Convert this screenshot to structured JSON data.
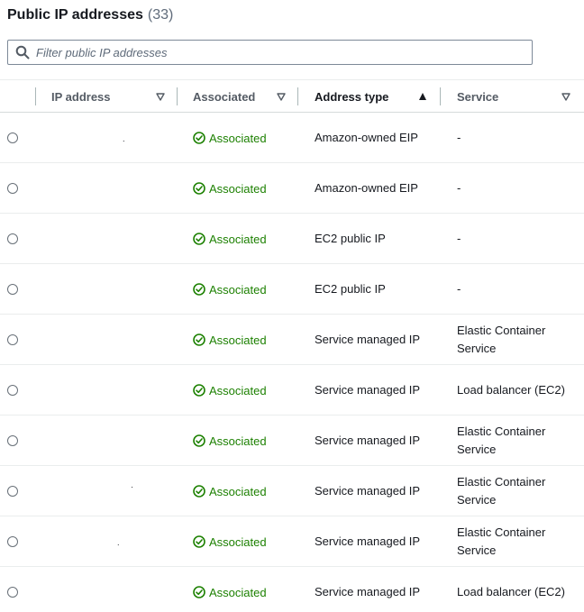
{
  "header": {
    "title": "Public IP addresses",
    "count": "(33)"
  },
  "filter": {
    "placeholder": "Filter public IP addresses"
  },
  "columns": [
    {
      "label": "IP address"
    },
    {
      "label": "Associated"
    },
    {
      "label": "Address type"
    },
    {
      "label": "Service"
    }
  ],
  "rows": [
    {
      "status": "Associated",
      "address_type": "Amazon-owned EIP",
      "service": "-",
      "ip_fragment": "."
    },
    {
      "status": "Associated",
      "address_type": "Amazon-owned EIP",
      "service": "-",
      "ip_fragment": ""
    },
    {
      "status": "Associated",
      "address_type": "EC2 public IP",
      "service": "-",
      "ip_fragment": ""
    },
    {
      "status": "Associated",
      "address_type": "EC2 public IP",
      "service": "-",
      "ip_fragment": ""
    },
    {
      "status": "Associated",
      "address_type": "Service managed IP",
      "service": "Elastic Container Service",
      "ip_fragment": ""
    },
    {
      "status": "Associated",
      "address_type": "Service managed IP",
      "service": "Load balancer (EC2)",
      "ip_fragment": ""
    },
    {
      "status": "Associated",
      "address_type": "Service managed IP",
      "service": "Elastic Container Service",
      "ip_fragment": ""
    },
    {
      "status": "Associated",
      "address_type": "Service managed IP",
      "service": "Elastic Container Service",
      "ip_fragment": "·"
    },
    {
      "status": "Associated",
      "address_type": "Service managed IP",
      "service": "Elastic Container Service",
      "ip_fragment": "."
    },
    {
      "status": "Associated",
      "address_type": "Service managed IP",
      "service": "Load balancer (EC2)",
      "ip_fragment": ""
    }
  ],
  "colors": {
    "status_green": "#1d8102",
    "text": "#16191f",
    "muted": "#545b64"
  }
}
